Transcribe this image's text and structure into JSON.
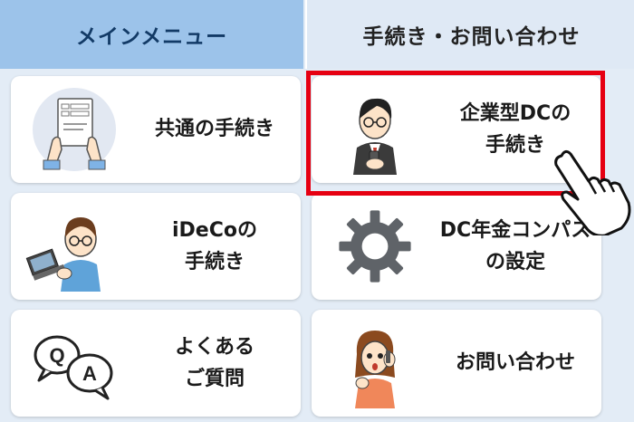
{
  "tabs": {
    "main": "メインメニュー",
    "procedures": "手続き・お問い合わせ"
  },
  "menu": {
    "common": "共通の手続き",
    "corporate_dc": "企業型DCの\n手続き",
    "ideco": "iDeCoの\n手続き",
    "compass": "DC年金コンパス\nの設定",
    "faq": "よくある\nご質問",
    "contact": "お問い合わせ"
  },
  "colors": {
    "highlight": "#e60012",
    "tab_active": "#9cc3ea"
  }
}
